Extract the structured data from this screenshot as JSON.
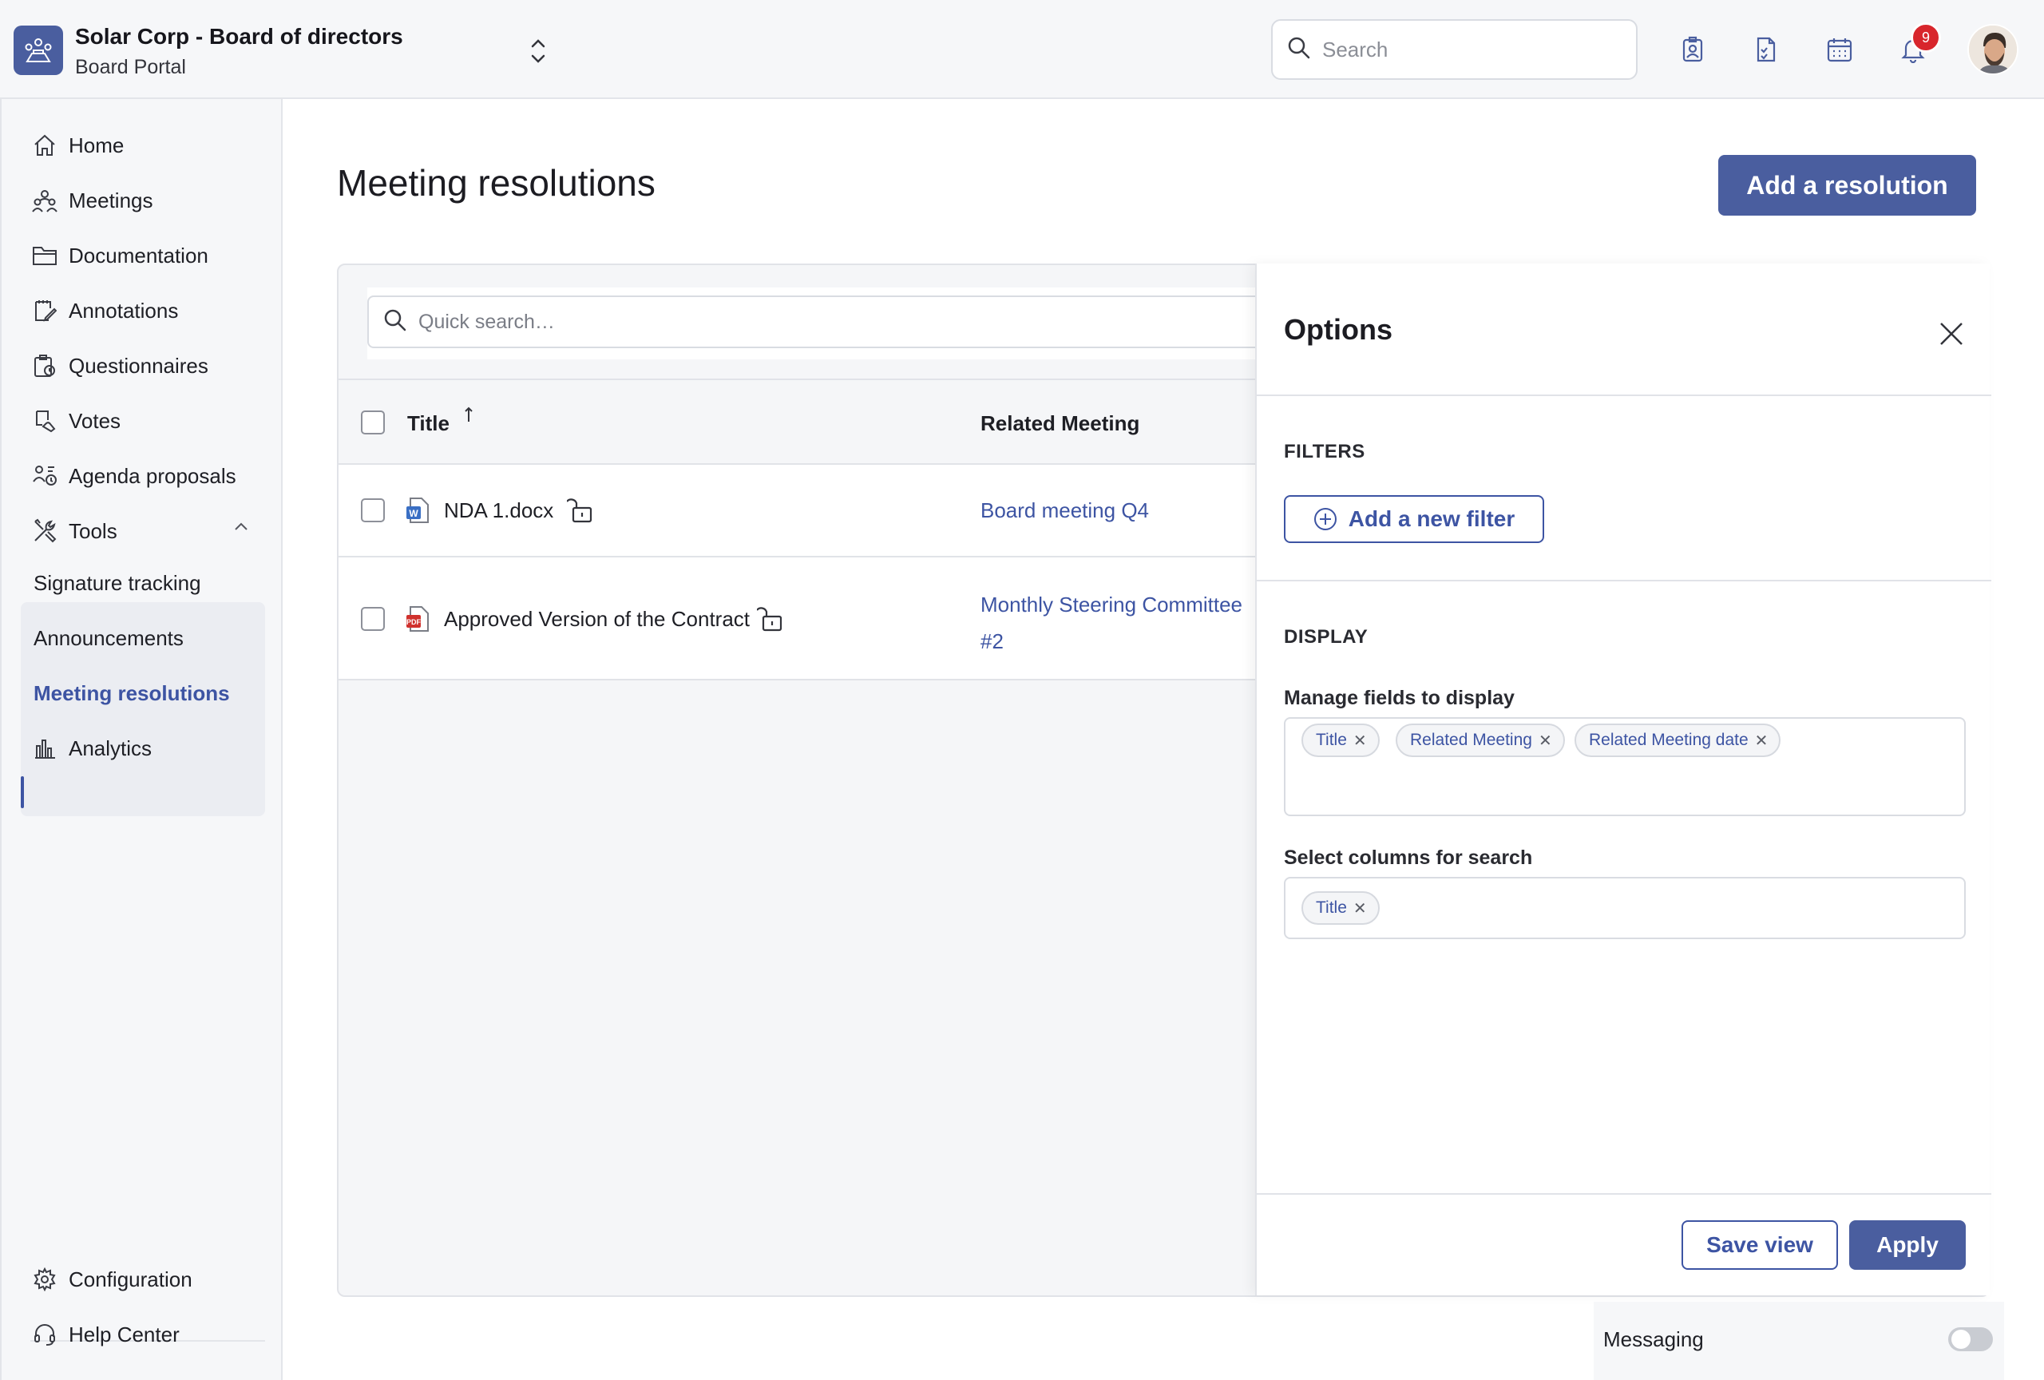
{
  "header": {
    "org_name": "Solar Corp - Board of directors",
    "portal_name": "Board Portal",
    "search_placeholder": "Search",
    "notification_count": "9"
  },
  "sidebar": {
    "items": [
      {
        "label": "Home",
        "icon": "home-icon"
      },
      {
        "label": "Meetings",
        "icon": "people-icon"
      },
      {
        "label": "Documentation",
        "icon": "folder-icon"
      },
      {
        "label": "Annotations",
        "icon": "annotation-icon"
      },
      {
        "label": "Questionnaires",
        "icon": "questionnaire-icon"
      },
      {
        "label": "Votes",
        "icon": "vote-icon"
      },
      {
        "label": "Agenda proposals",
        "icon": "agenda-icon"
      }
    ],
    "tools": {
      "label": "Tools",
      "sub_items": [
        "Signature tracking",
        "Announcements",
        "Meeting resolutions"
      ],
      "active": "Meeting resolutions"
    },
    "analytics_label": "Analytics",
    "configuration_label": "Configuration",
    "help_label": "Help Center"
  },
  "main": {
    "title": "Meeting resolutions",
    "add_button": "Add a resolution",
    "quick_search_placeholder": "Quick search…",
    "columns": {
      "title": "Title",
      "related_meeting": "Related Meeting"
    },
    "rows": [
      {
        "title": "NDA 1.docx",
        "file_type": "word",
        "meeting": "Board meeting Q4"
      },
      {
        "title": "Approved Version of the Contract",
        "file_type": "pdf",
        "meeting": "Monthly Steering Committee #2"
      }
    ]
  },
  "options": {
    "title": "Options",
    "filters_label": "FILTERS",
    "add_filter": "Add a new filter",
    "display_label": "DISPLAY",
    "manage_fields_label": "Manage fields to display",
    "display_fields": [
      "Title",
      "Related Meeting",
      "Related Meeting date"
    ],
    "search_columns_label": "Select columns for search",
    "search_columns": [
      "Title"
    ],
    "save_view": "Save view",
    "apply": "Apply"
  },
  "messaging": {
    "label": "Messaging",
    "enabled": false
  },
  "colors": {
    "primary": "#4a5e9f",
    "link": "#3d54a3",
    "badge": "#d8262c"
  }
}
